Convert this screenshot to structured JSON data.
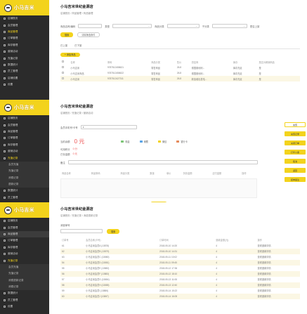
{
  "app": {
    "title": "小马吉米世纪金源店",
    "logo": "小马吉米"
  },
  "screens": [
    {
      "breadcrumb": "店铺首页 / 商品管理 / 商品管理",
      "filters": [
        {
          "label": "商品名称/编码",
          "placeholder": ""
        },
        {
          "label": "类型",
          "placeholder": ""
        },
        {
          "label": "商品分类",
          "placeholder": ""
        },
        {
          "label": "子分类",
          "placeholder": ""
        },
        {
          "label": "是否上架",
          "placeholder": ""
        }
      ],
      "search_label": "搜索",
      "reset_label": "清除筛选条件",
      "tabs": [
        "已上架",
        "已下架"
      ],
      "add_label": "+ 添加商品",
      "columns": [
        "",
        "名称",
        "条码",
        "商品分类",
        "售价",
        "供应商",
        "库存",
        "是否为畅销商品"
      ],
      "rows": [
        [
          "",
          "小马吉米",
          "9787512458621",
          "零售商品",
          "26.8",
          "德国奥地利...",
          "库存充足",
          "是"
        ],
        [
          "",
          "小马吉米商品",
          "9787512458622",
          "零售商品",
          "26.8",
          "德国奥地利...",
          "库存充足",
          "是"
        ],
        [
          "",
          "小马吉米",
          "9787512427311",
          "零售商品",
          "26.8",
          "新加坡出发哈...",
          "库存充足",
          "是"
        ]
      ]
    },
    {
      "title": "小马吉米世纪金源店",
      "breadcrumb": "店铺首页 / 充值记录 / 营销活动",
      "member_label": "会员手机号/卡号",
      "member_value": "1",
      "balance_label": "当前余额",
      "balance": "0 元",
      "points_label": "可用积分",
      "points": "0 分",
      "deposit_label": "已存金额",
      "deposit": "0 元",
      "pay_methods": [
        {
          "label": "现金",
          "color": "#7cc576"
        },
        {
          "label": "储蓄",
          "color": "#5ba4e6"
        },
        {
          "label": "微信",
          "color": "#f3d31c"
        },
        {
          "label": "银行卡",
          "color": "#e58a5b"
        }
      ],
      "remark_label": "备注",
      "grid_columns": [
        "商品名称",
        "商品条码",
        "商品分类",
        "数量",
        "单价",
        "折扣金额",
        "应付金额",
        "操作"
      ],
      "submit_label": "提交",
      "side_label": "充值",
      "side_buttons": [
        "充值记录",
        "关闭订单",
        "打印小票",
        "取消",
        "返回",
        "挂单备注"
      ]
    },
    {
      "title": "小马吉米世纪金源店",
      "breadcrumb": "店铺首页 / 充值记录 / 消费退款记录",
      "filter_label": "消费单号",
      "search_label": "搜索",
      "columns": [
        "订单号",
        "会员名称(卡号)",
        "订单时间",
        "退款金额(元)",
        "操作"
      ],
      "rows": [
        [
          "61",
          "小马吉米会员A (13878)",
          "2018-05-10 14:20",
          "4",
          "查看退款详情"
        ],
        [
          "62",
          "小马吉米会员B (13879)",
          "2018-05-10 14:31",
          "4",
          "查看退款详情"
        ],
        [
          "63",
          "小马吉米会员C (13880)",
          "2018-05-11 10:02",
          "4",
          "查看退款详情"
        ],
        [
          "54",
          "小马吉米会员D (13881)",
          "2018-05-11 09:45",
          "4",
          "查看退款详情"
        ],
        [
          "55",
          "小马吉米会员E (13882)",
          "2018-05-12 17:36",
          "4",
          "查看退款详情"
        ],
        [
          "56",
          "小马吉米会员F (13883)",
          "2018-05-12 18:10",
          "4",
          "查看退款详情"
        ],
        [
          "57",
          "小马吉米会员G (13884)",
          "2018-05-13 11:08",
          "4",
          "查看退款详情"
        ],
        [
          "58",
          "小马吉米会员H (13885)",
          "2018-05-13 12:40",
          "4",
          "查看退款详情"
        ],
        [
          "59",
          "小马吉米会员I (13886)",
          "2018-05-14 15:22",
          "4",
          "查看退款详情"
        ],
        [
          "60",
          "小马吉米会员J (13887)",
          "2018-05-14 16:05",
          "4",
          "查看退款详情"
        ]
      ]
    }
  ],
  "nav": [
    [
      {
        "label": "店铺首页",
        "sub": false
      },
      {
        "label": "会员管理",
        "sub": false
      },
      {
        "label": "商品管理",
        "sub": false,
        "active": true
      },
      {
        "label": "订单管理",
        "sub": false
      },
      {
        "label": "库存管理",
        "sub": false
      },
      {
        "label": "营销活动",
        "sub": false
      },
      {
        "label": "充值记录",
        "sub": false
      },
      {
        "label": "数据统计",
        "sub": false
      },
      {
        "label": "员工管理",
        "sub": false
      },
      {
        "label": "店铺设置",
        "sub": false
      },
      {
        "label": "设置",
        "sub": false
      }
    ],
    [
      {
        "label": "店铺首页",
        "sub": false
      },
      {
        "label": "会员管理",
        "sub": false
      },
      {
        "label": "商品管理",
        "sub": false
      },
      {
        "label": "订单管理",
        "sub": false
      },
      {
        "label": "库存管理",
        "sub": false
      },
      {
        "label": "营销活动",
        "sub": false
      },
      {
        "label": "充值记录",
        "sub": false,
        "active": true
      },
      {
        "label": "会员充值",
        "sub": true
      },
      {
        "label": "充值记录",
        "sub": true
      },
      {
        "label": "消费记录",
        "sub": true
      },
      {
        "label": "退款记录",
        "sub": true
      },
      {
        "label": "数据统计",
        "sub": false
      },
      {
        "label": "员工管理",
        "sub": false
      }
    ],
    [
      {
        "label": "店铺首页",
        "sub": false
      },
      {
        "label": "会员管理",
        "sub": false
      },
      {
        "label": "商品管理",
        "sub": false,
        "highlight": true
      },
      {
        "label": "订单管理",
        "sub": false
      },
      {
        "label": "库存管理",
        "sub": false
      },
      {
        "label": "营销活动",
        "sub": false
      },
      {
        "label": "充值记录",
        "sub": false,
        "active": true
      },
      {
        "label": "会员充值",
        "sub": true
      },
      {
        "label": "充值记录",
        "sub": true
      },
      {
        "label": "消费退款记录",
        "sub": true
      },
      {
        "label": "消费记录",
        "sub": true
      },
      {
        "label": "数据统计",
        "sub": false
      },
      {
        "label": "员工管理",
        "sub": false
      },
      {
        "label": "设置",
        "sub": false
      }
    ]
  ]
}
